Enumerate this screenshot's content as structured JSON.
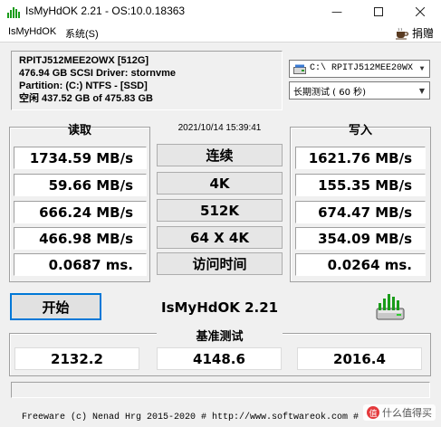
{
  "window": {
    "title": "IsMyHdOK 2.21 - OS:10.0.18363",
    "icon": "app-disk-icon"
  },
  "menu": {
    "items": [
      "IsMyHdOK",
      "系统(S)"
    ],
    "donate_label": "捐赠",
    "donate_icon": "coffee-cup-icon"
  },
  "drive_info": {
    "line1": "RPITJ512MEE2OWX [512G]",
    "line2": "476.94 GB  SCSI Driver: stornvme",
    "line3": "Partition: (C:) NTFS - [SSD]",
    "line4": "空闲 437.52 GB of 475.83 GB"
  },
  "drive_select": {
    "value": "C:\\ RPITJ512MEE20WX"
  },
  "test_select": {
    "value": "长期测试 ( 60 秒)"
  },
  "read": {
    "title": "读取",
    "values": [
      "1734.59 MB/s",
      "59.66 MB/s",
      "666.24 MB/s",
      "466.98 MB/s",
      "0.0687 ms."
    ]
  },
  "write": {
    "title": "写入",
    "values": [
      "1621.76 MB/s",
      "155.35 MB/s",
      "674.47 MB/s",
      "354.09 MB/s",
      "0.0264 ms."
    ]
  },
  "timestamp": "2021/10/14 15:39:41",
  "tests": [
    "连续",
    "4K",
    "512K",
    "64 X 4K",
    "访问时间"
  ],
  "start_label": "开始",
  "brand": "IsMyHdOK 2.21",
  "benchmark": {
    "label": "基准测试",
    "values": [
      "2132.2",
      "4148.6",
      "2016.4"
    ]
  },
  "footer": "Freeware (c) Nenad Hrg 2015-2020 # http://www.softwareok.com  #",
  "watermark": {
    "text": "什么值得买",
    "badge": "值"
  },
  "colors": {
    "accent": "#0078d7",
    "panel": "#f0f0f0",
    "bars": "#1a9c1a"
  }
}
